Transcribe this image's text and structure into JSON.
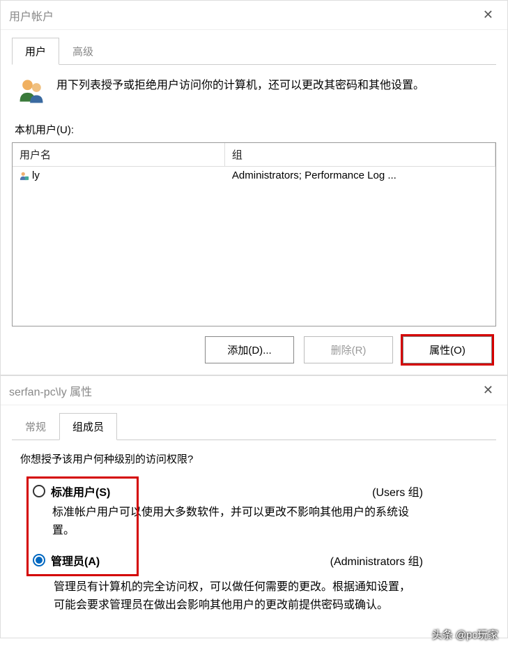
{
  "dialog1": {
    "title": "用户帐户",
    "close": "✕",
    "tabs": {
      "users": "用户",
      "advanced": "高级"
    },
    "intro": "用下列表授予或拒绝用户访问你的计算机，还可以更改其密码和其他设置。",
    "local_users_label": "本机用户(U):",
    "columns": {
      "user": "用户名",
      "group": "组"
    },
    "rows": [
      {
        "user": "ly",
        "group": "Administrators; Performance Log ..."
      }
    ],
    "buttons": {
      "add": "添加(D)...",
      "remove": "删除(R)",
      "properties": "属性(O)"
    }
  },
  "dialog2": {
    "title": "serfan-pc\\ly 属性",
    "close": "✕",
    "tabs": {
      "general": "常规",
      "members": "组成员"
    },
    "question": "你想授予该用户何种级别的访问权限?",
    "options": {
      "standard": {
        "label": "标准用户(S)",
        "group": "(Users 组)",
        "desc": "标准帐户用户可以使用大多数软件，并可以更改不影响其他用户的系统设置。"
      },
      "admin": {
        "label": "管理员(A)",
        "group": "(Administrators 组)",
        "desc": "管理员有计算机的完全访问权，可以做任何需要的更改。根据通知设置，可能会要求管理员在做出会影响其他用户的更改前提供密码或确认。"
      }
    }
  },
  "watermark": "头条 @pc玩家"
}
